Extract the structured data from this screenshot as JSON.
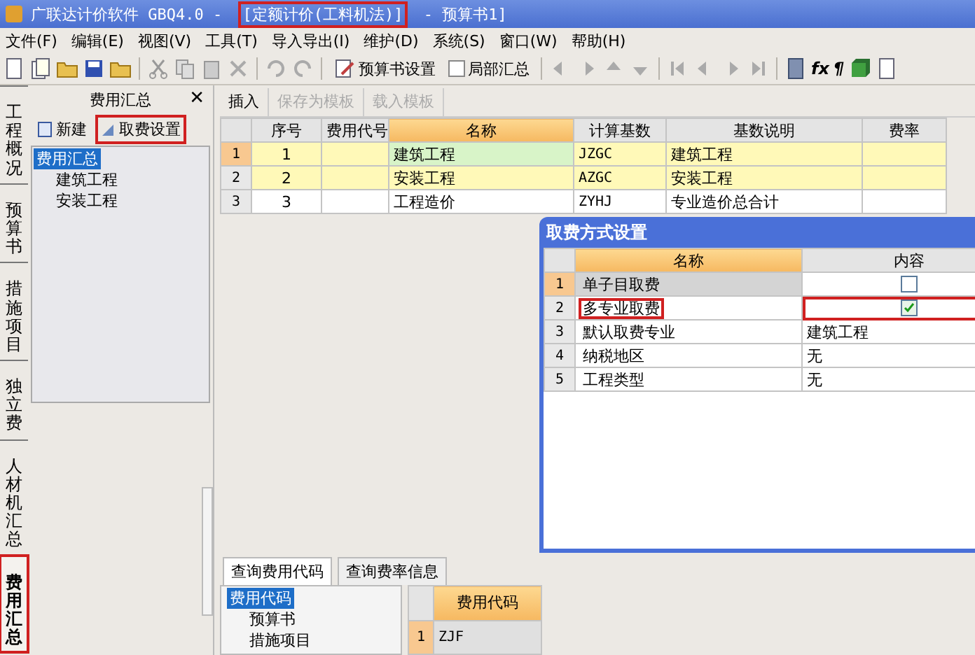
{
  "window": {
    "title_parts": [
      {
        "text": "广联达计价软件 GBQ4.0 - ",
        "highlighted": false
      },
      {
        "text": "[定额计价(工料机法)]",
        "highlighted": true
      },
      {
        "text": " - 预算书1]",
        "highlighted": false
      }
    ]
  },
  "menu": [
    "文件(F)",
    "编辑(E)",
    "视图(V)",
    "工具(T)",
    "导入导出(I)",
    "维护(D)",
    "系统(S)",
    "窗口(W)",
    "帮助(H)"
  ],
  "toolbar": [
    {
      "kind": "icon"
    },
    {
      "kind": "icon"
    },
    {
      "kind": "icon"
    },
    {
      "kind": "icon"
    },
    {
      "kind": "icon"
    },
    {
      "kind": "sep"
    },
    {
      "kind": "icon"
    },
    {
      "kind": "icon"
    },
    {
      "kind": "icon"
    },
    {
      "kind": "icon"
    },
    {
      "kind": "sep"
    },
    {
      "kind": "icon"
    },
    {
      "kind": "icon"
    },
    {
      "kind": "sep"
    },
    {
      "kind": "button",
      "label": "预算书设置"
    },
    {
      "kind": "check",
      "label": "局部汇总",
      "checked": false
    },
    {
      "kind": "sep"
    },
    {
      "kind": "icon"
    },
    {
      "kind": "icon"
    },
    {
      "kind": "icon"
    },
    {
      "kind": "icon"
    },
    {
      "kind": "sep"
    },
    {
      "kind": "icon"
    },
    {
      "kind": "icon"
    },
    {
      "kind": "icon"
    },
    {
      "kind": "icon"
    },
    {
      "kind": "sep"
    },
    {
      "kind": "icon"
    },
    {
      "kind": "text",
      "label": "fx"
    },
    {
      "kind": "text",
      "label": "¶"
    },
    {
      "kind": "icon"
    },
    {
      "kind": "icon"
    }
  ],
  "side_tabs": [
    {
      "label": "工程概况",
      "selected": false,
      "highlighted": false
    },
    {
      "label": "预算书",
      "selected": false,
      "highlighted": false
    },
    {
      "label": "措施项目",
      "selected": false,
      "highlighted": false
    },
    {
      "label": "独立费",
      "selected": false,
      "highlighted": false
    },
    {
      "label": "人材机汇总",
      "selected": false,
      "highlighted": false
    },
    {
      "label": "费用汇总",
      "selected": true,
      "highlighted": true
    }
  ],
  "panel": {
    "title": "费用汇总",
    "close": "✕",
    "buttons": [
      {
        "label": "新建",
        "highlighted": false
      },
      {
        "label": "取费设置",
        "highlighted": true
      }
    ],
    "tree": [
      {
        "label": "费用汇总",
        "selected": true,
        "children": [
          {
            "label": "建筑工程",
            "selected": false
          },
          {
            "label": "安装工程",
            "selected": false
          }
        ]
      }
    ]
  },
  "main_toolbar": [
    {
      "label": "插入",
      "disabled": false
    },
    {
      "label": "保存为模板",
      "disabled": true
    },
    {
      "label": "载入模板",
      "disabled": true
    }
  ],
  "table": {
    "columns": [
      "序号",
      "费用代号",
      "名称",
      "计算基数",
      "基数说明",
      "费率"
    ],
    "rows": [
      {
        "num": "1",
        "selected": true,
        "tinted": true,
        "cells": [
          "1",
          "",
          "建筑工程",
          "JZGC",
          "建筑工程",
          ""
        ]
      },
      {
        "num": "2",
        "selected": false,
        "tinted": true,
        "cells": [
          "2",
          "",
          "安装工程",
          "AZGC",
          "安装工程",
          ""
        ]
      },
      {
        "num": "3",
        "selected": false,
        "tinted": false,
        "cells": [
          "3",
          "",
          "工程造价",
          "ZYHJ",
          "专业造价总合计",
          ""
        ]
      }
    ]
  },
  "bottom": {
    "tabs": [
      {
        "label": "查询费用代码",
        "selected": true
      },
      {
        "label": "查询费率信息",
        "selected": false
      }
    ],
    "tree": [
      {
        "label": "费用代码",
        "selected": true,
        "children": [
          {
            "label": "预算书",
            "selected": false
          },
          {
            "label": "措施项目",
            "selected": false
          }
        ]
      }
    ],
    "grid": {
      "column": "费用代码",
      "rows": [
        {
          "num": "1",
          "selected": true,
          "value": "ZJF"
        }
      ]
    }
  },
  "dialog": {
    "title": "取费方式设置",
    "columns": [
      "名称",
      "内容"
    ],
    "rows": [
      {
        "num": "1",
        "name": "单子目取费",
        "selected": true,
        "highlighted": false,
        "kind": "checkbox",
        "checked": false,
        "cell_highlighted": false
      },
      {
        "num": "2",
        "name": "多专业取费",
        "selected": false,
        "highlighted": true,
        "kind": "checkbox",
        "checked": true,
        "cell_highlighted": true
      },
      {
        "num": "3",
        "name": "默认取费专业",
        "selected": false,
        "highlighted": false,
        "kind": "text",
        "value": "建筑工程"
      },
      {
        "num": "4",
        "name": "纳税地区",
        "selected": false,
        "highlighted": false,
        "kind": "text",
        "value": "无"
      },
      {
        "num": "5",
        "name": "工程类型",
        "selected": false,
        "highlighted": false,
        "kind": "text",
        "value": "无"
      }
    ]
  }
}
